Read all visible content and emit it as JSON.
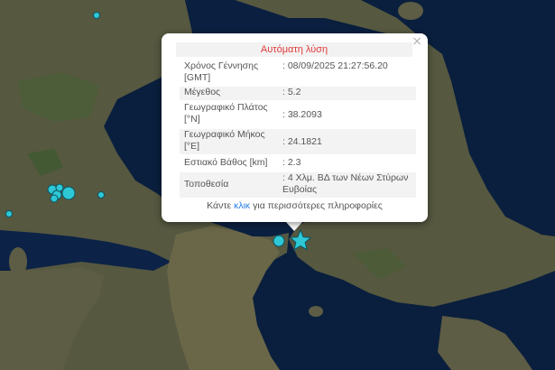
{
  "popup": {
    "title": "Αυτόματη λύση",
    "close_label": "×",
    "rows": [
      {
        "label": "Χρόνος Γέννησης [GMT]",
        "value": ": 08/09/2025 21:27:56.20"
      },
      {
        "label": "Μέγεθος",
        "value": ": 5.2"
      },
      {
        "label": "Γεωγραφικό Πλάτος [°N]",
        "value": ": 38.2093"
      },
      {
        "label": "Γεωγραφικό Μήκος [°E]",
        "value": ": 24.1821"
      },
      {
        "label": "Εστιακό Βάθος [km]",
        "value": ": 2.3"
      },
      {
        "label": "Τοποθεσία",
        "value": ": 4 Χλμ. ΒΔ των Νέων Στύρων Ευβοίας"
      }
    ],
    "more_pre": "Κάντε ",
    "more_link": "κλικ",
    "more_post": " για περισσότερες πληροφορίες"
  },
  "epicenter_icon": "star-icon",
  "colors": {
    "sea": "#0a1f3d",
    "land": "#5b5a42",
    "marker": "#2ec7d6",
    "title_red": "#e03b3b",
    "link_blue": "#2a7be4"
  }
}
